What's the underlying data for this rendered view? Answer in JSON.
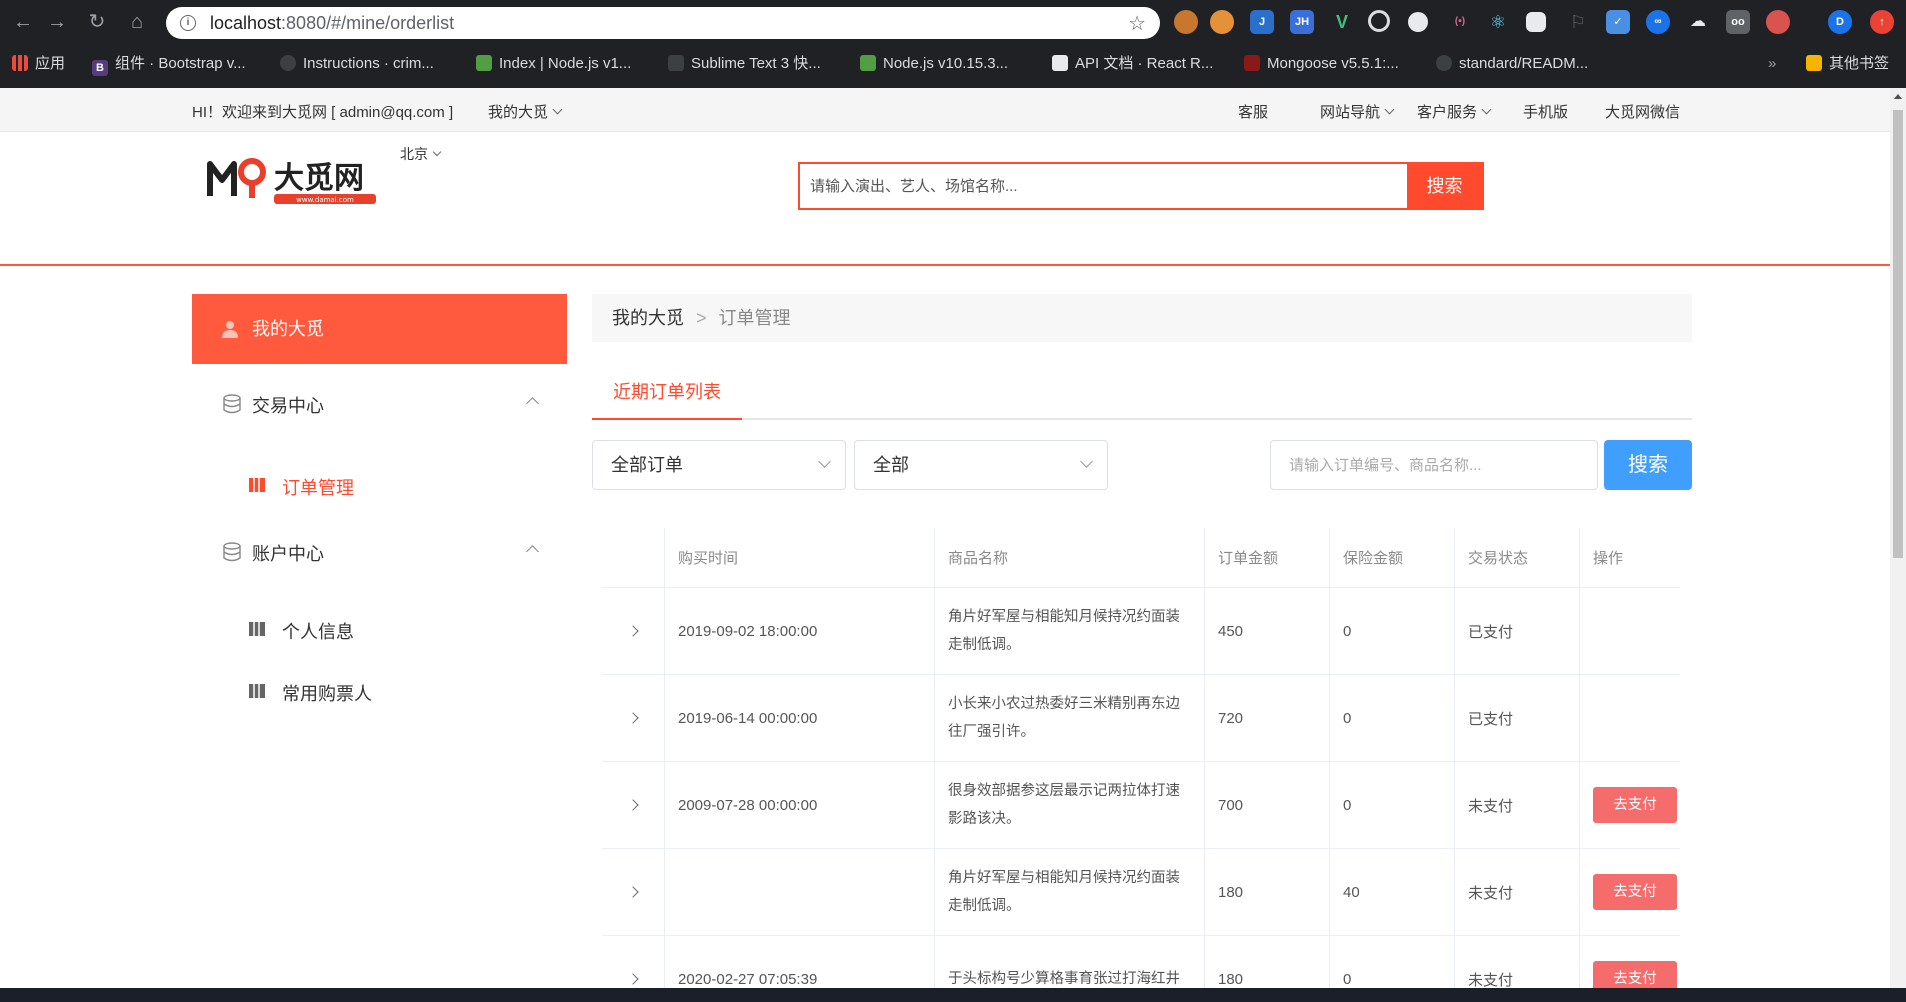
{
  "browser": {
    "url_host": "localhost",
    "url_path": ":8080/#/mine/orderlist",
    "bookmarks": [
      {
        "label": "应用"
      },
      {
        "label": "组件 · Bootstrap v..."
      },
      {
        "label": "Instructions · crim..."
      },
      {
        "label": "Index | Node.js v1..."
      },
      {
        "label": "Sublime Text 3 快..."
      },
      {
        "label": "Node.js v10.15.3..."
      },
      {
        "label": "API 文档 · React R..."
      },
      {
        "label": "Mongoose v5.5.1:..."
      },
      {
        "label": "standard/READM..."
      },
      {
        "label": "其他书签"
      }
    ],
    "more_bookmarks": "»",
    "profile_initial": "D",
    "ext_labels": [
      "J",
      "JH",
      "V"
    ]
  },
  "topbar": {
    "greeting": "HI！欢迎来到大觅网 [ admin@qq.com ]",
    "mine": "我的大觅",
    "links": [
      "客服",
      "网站导航",
      "客户服务",
      "手机版",
      "大觅网微信"
    ]
  },
  "header": {
    "logo_text": "大觅网",
    "logo_sub": "www.damai.com",
    "city": "北京",
    "search_placeholder": "请输入演出、艺人、场馆名称...",
    "search_button": "搜索"
  },
  "sidebar": {
    "title": "我的大觅",
    "groups": [
      {
        "label": "交易中心",
        "items": [
          {
            "label": "订单管理",
            "active": true
          }
        ]
      },
      {
        "label": "账户中心",
        "items": [
          {
            "label": "个人信息"
          },
          {
            "label": "常用购票人"
          }
        ]
      }
    ]
  },
  "main": {
    "breadcrumb": [
      "我的大觅",
      "订单管理"
    ],
    "breadcrumb_sep": ">",
    "tab": "近期订单列表",
    "filter_order_type": "全部订单",
    "filter_status": "全部",
    "search_placeholder": "请输入订单编号、商品名称...",
    "search_button": "搜索",
    "columns": [
      "购买时间",
      "商品名称",
      "订单金额",
      "保险金额",
      "交易状态",
      "操作"
    ],
    "rows": [
      {
        "time": "2019-09-02 18:00:00",
        "name": "角片好军屋与相能知月候持况约面装走制低调。",
        "amount": "450",
        "insurance": "0",
        "status": "已支付",
        "action": ""
      },
      {
        "time": "2019-06-14 00:00:00",
        "name": "小长来小农过热委好三米精别再东边往厂强引许。",
        "amount": "720",
        "insurance": "0",
        "status": "已支付",
        "action": ""
      },
      {
        "time": "2009-07-28 00:00:00",
        "name": "很身效部据参这层最示记两拉体打速影路该决。",
        "amount": "700",
        "insurance": "0",
        "status": "未支付",
        "action": "去支付"
      },
      {
        "time": "",
        "name": "角片好军屋与相能知月候持况约面装走制低调。",
        "amount": "180",
        "insurance": "40",
        "status": "未支付",
        "action": "去支付"
      },
      {
        "time": "2020-02-27 07:05:39",
        "name": "于头标构号少算格事育张过打海红井",
        "amount": "180",
        "insurance": "0",
        "status": "未支付",
        "action": "去支付"
      }
    ]
  }
}
